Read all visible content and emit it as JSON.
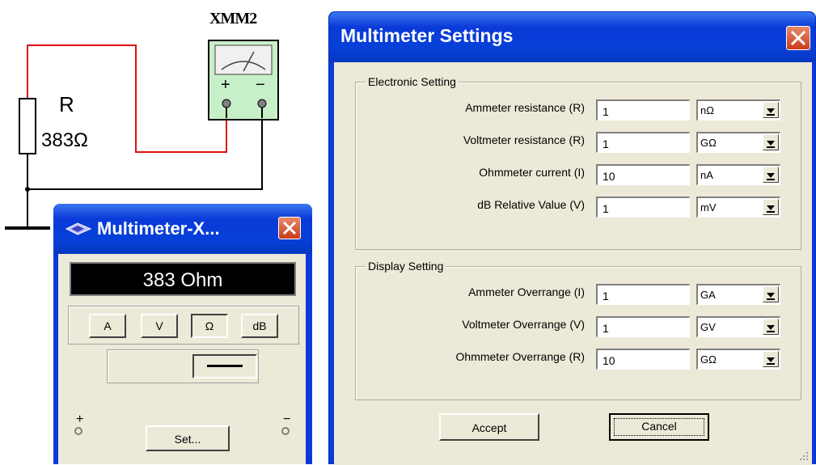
{
  "schematic": {
    "instrument_label": "XMM2",
    "resistor_name": "R",
    "resistor_value": "383Ω",
    "plus": "+",
    "minus": "−",
    "wire_color": "#e01010"
  },
  "multimeter": {
    "title": "Multimeter-X...",
    "display_value": "383 Ohm",
    "modes": [
      "A",
      "V",
      "Ω",
      "dB"
    ],
    "selected_mode": "Ω",
    "plus": "+",
    "minus": "−",
    "set_button": "Set..."
  },
  "settings": {
    "title": "Multimeter Settings",
    "electronic": {
      "group_title": "Electronic Setting",
      "rows": [
        {
          "label": "Ammeter resistance (R)",
          "value": "1",
          "unit": "nΩ"
        },
        {
          "label": "Voltmeter resistance (R)",
          "value": "1",
          "unit": "GΩ"
        },
        {
          "label": "Ohmmeter current (I)",
          "value": "10",
          "unit": "nA"
        },
        {
          "label": "dB Relative Value (V)",
          "value": "1",
          "unit": "mV"
        }
      ]
    },
    "display": {
      "group_title": "Display Setting",
      "rows": [
        {
          "label": "Ammeter Overrange (I)",
          "value": "1",
          "unit": "GA"
        },
        {
          "label": "Voltmeter Overrange (V)",
          "value": "1",
          "unit": "GV"
        },
        {
          "label": "Ohmmeter Overrange (R)",
          "value": "10",
          "unit": "GΩ"
        }
      ]
    },
    "accept_button": "Accept",
    "cancel_button": "Cancel"
  },
  "colors": {
    "titlebar_blue": "#0a3ad8",
    "window_face": "#ece9d8",
    "meter_green": "#c8f0c8",
    "close_red": "#d9502c"
  }
}
